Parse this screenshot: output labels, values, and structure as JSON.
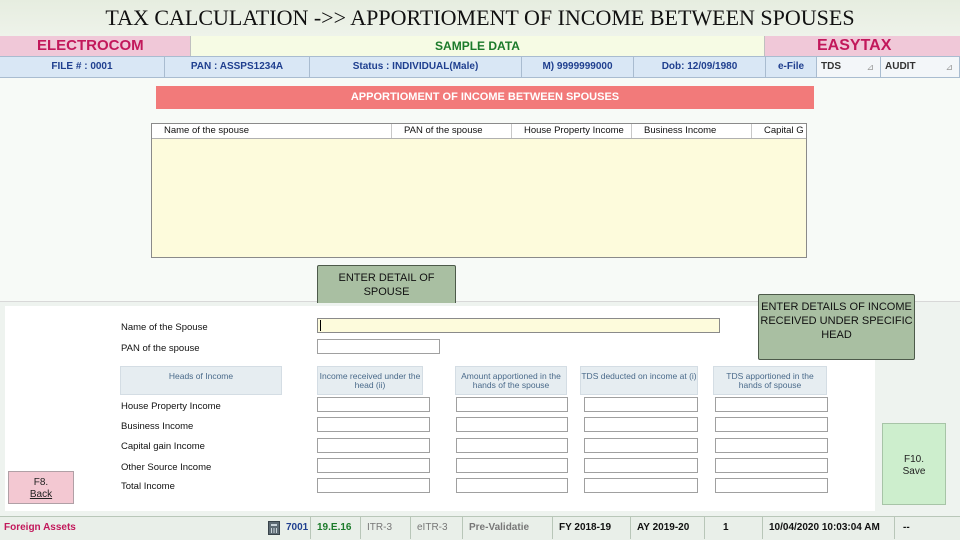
{
  "slide": {
    "title": "TAX CALCULATION ->> APPORTIOMENT OF INCOME BETWEEN SPOUSES"
  },
  "brand": {
    "left": "ELECTROCOM",
    "center": "SAMPLE DATA",
    "right": "EASYTAX"
  },
  "info": {
    "file": "FILE # : 0001",
    "pan": "PAN : ASSPS1234A",
    "status": "Status : INDIVIDUAL(Male)",
    "mobile": "M) 9999999000",
    "dob": "Dob: 12/09/1980",
    "efile": "e-File",
    "tds": "TDS",
    "audit": "AUDIT"
  },
  "section": {
    "title": "APPORTIOMENT OF INCOME BETWEEN SPOUSES"
  },
  "grid": {
    "columns": [
      "Name of the spouse",
      "PAN of the spouse",
      "House Property Income",
      "Business Income",
      "Capital G"
    ]
  },
  "callouts": {
    "spouse": "ENTER DETAIL OF SPOUSE",
    "income": "ENTER DETAILS OF INCOME RECEIVED UNDER SPECIFIC HEAD"
  },
  "form": {
    "spouse_name_label": "Name of the Spouse",
    "spouse_pan_label": "PAN of the spouse",
    "heads_label": "Heads of Income",
    "columns": [
      "Income received under the head (ii)",
      "Amount apportioned in the hands of the spouse",
      "TDS deducted on income at (i)",
      "TDS apportioned in the hands of spouse"
    ],
    "rows": [
      "House Property Income",
      "Business Income",
      "Capital gain Income",
      "Other Source Income",
      "Total Income"
    ]
  },
  "buttons": {
    "back_key": "F8.",
    "back_label": "Back",
    "save_key": "F10.",
    "save_label": "Save"
  },
  "status_bar": {
    "foreign_assets": "Foreign Assets",
    "code": "7001",
    "version": "19.E.16",
    "itr": "ITR-3",
    "eitr": "eITR-3",
    "prevalidate": "Pre-Validatie",
    "fy": "FY 2018-19",
    "ay": "AY 2019-20",
    "count": "1",
    "datetime": "10/04/2020 10:03:04 AM",
    "dash": "--"
  },
  "icons": {
    "calculator": "calculator-icon",
    "collapse": "collapse-icon"
  }
}
